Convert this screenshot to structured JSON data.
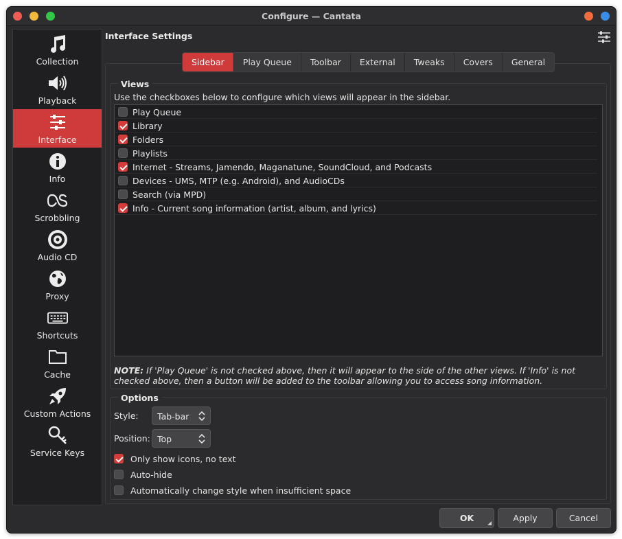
{
  "window": {
    "title": "Configure — Cantata"
  },
  "sidebar": {
    "items": [
      {
        "label": "Collection",
        "icon": "music-note-icon"
      },
      {
        "label": "Playback",
        "icon": "speaker-icon"
      },
      {
        "label": "Interface",
        "icon": "sliders-icon",
        "active": true
      },
      {
        "label": "Info",
        "icon": "info-icon"
      },
      {
        "label": "Scrobbling",
        "icon": "lastfm-icon"
      },
      {
        "label": "Audio CD",
        "icon": "disc-icon"
      },
      {
        "label": "Proxy",
        "icon": "globe-icon"
      },
      {
        "label": "Shortcuts",
        "icon": "keyboard-icon"
      },
      {
        "label": "Cache",
        "icon": "folder-icon"
      },
      {
        "label": "Custom Actions",
        "icon": "rocket-icon"
      },
      {
        "label": "Service Keys",
        "icon": "key-icon"
      }
    ]
  },
  "header": {
    "title": "Interface Settings"
  },
  "tabs": [
    {
      "label": "Sidebar",
      "active": true
    },
    {
      "label": "Play Queue"
    },
    {
      "label": "Toolbar"
    },
    {
      "label": "External"
    },
    {
      "label": "Tweaks"
    },
    {
      "label": "Covers"
    },
    {
      "label": "General"
    }
  ],
  "views": {
    "title": "Views",
    "description": "Use the checkboxes below to configure which views will appear in the sidebar.",
    "items": [
      {
        "label": "Play Queue",
        "checked": false
      },
      {
        "label": "Library",
        "checked": true
      },
      {
        "label": "Folders",
        "checked": true
      },
      {
        "label": "Playlists",
        "checked": false
      },
      {
        "label": "Internet - Streams, Jamendo, Maganatune, SoundCloud, and Podcasts",
        "checked": true
      },
      {
        "label": "Devices - UMS, MTP (e.g. Android), and AudioCDs",
        "checked": false
      },
      {
        "label": "Search (via MPD)",
        "checked": false
      },
      {
        "label": "Info - Current song information (artist, album, and lyrics)",
        "checked": true
      }
    ],
    "note_prefix": "NOTE:",
    "note_text": " If 'Play Queue' is not checked above, then it will appear to the side of the other views. If 'Info' is not checked above, then a button will be added to the toolbar allowing you to access song information."
  },
  "options": {
    "title": "Options",
    "style_label": "Style:",
    "style_value": "Tab-bar",
    "position_label": "Position:",
    "position_value": "Top",
    "checkboxes": [
      {
        "label": "Only show icons, no text",
        "checked": true
      },
      {
        "label": "Auto-hide",
        "checked": false
      },
      {
        "label": "Automatically change style when insufficient space",
        "checked": false
      }
    ]
  },
  "buttons": {
    "ok": "OK",
    "apply": "Apply",
    "cancel": "Cancel"
  },
  "colors": {
    "accent": "#cf3a3a",
    "background": "#2b2b2d",
    "sidebar": "#1f1f21"
  }
}
